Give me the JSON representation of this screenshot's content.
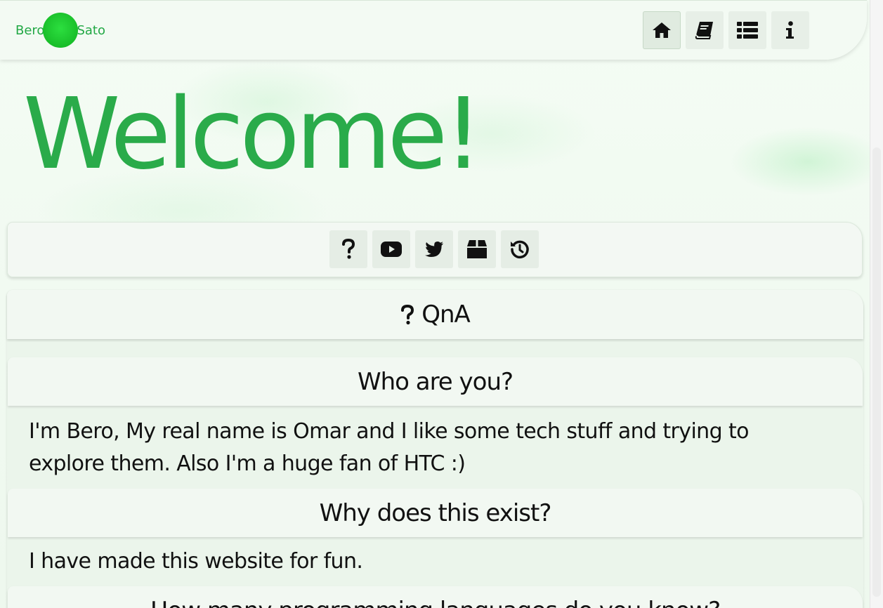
{
  "navbar": {
    "logo_left": "Bero",
    "logo_right": "Sato",
    "buttons": [
      {
        "icon": "home-icon",
        "active": true
      },
      {
        "icon": "book-icon",
        "active": false
      },
      {
        "icon": "list-icon",
        "active": false
      },
      {
        "icon": "info-icon",
        "active": false
      }
    ]
  },
  "hero": {
    "title": "Welcome!"
  },
  "social_bar": {
    "buttons": [
      "question-icon",
      "youtube-icon",
      "twitter-icon",
      "package-icon",
      "history-icon"
    ]
  },
  "qna": {
    "title": "QnA",
    "items": [
      {
        "question": "Who are you?",
        "answer": "I'm Bero, My real name is Omar and I like some tech stuff and trying to explore them. Also I'm a huge fan of HTC :)"
      },
      {
        "question": "Why does this exist?",
        "answer": "I have made this website for fun."
      },
      {
        "question": "How many programming languages do you know?",
        "answer": ""
      }
    ]
  },
  "colors": {
    "accent": "#2aab4a",
    "logo_dot": "#1ec832",
    "background": "#f1fbf1"
  }
}
